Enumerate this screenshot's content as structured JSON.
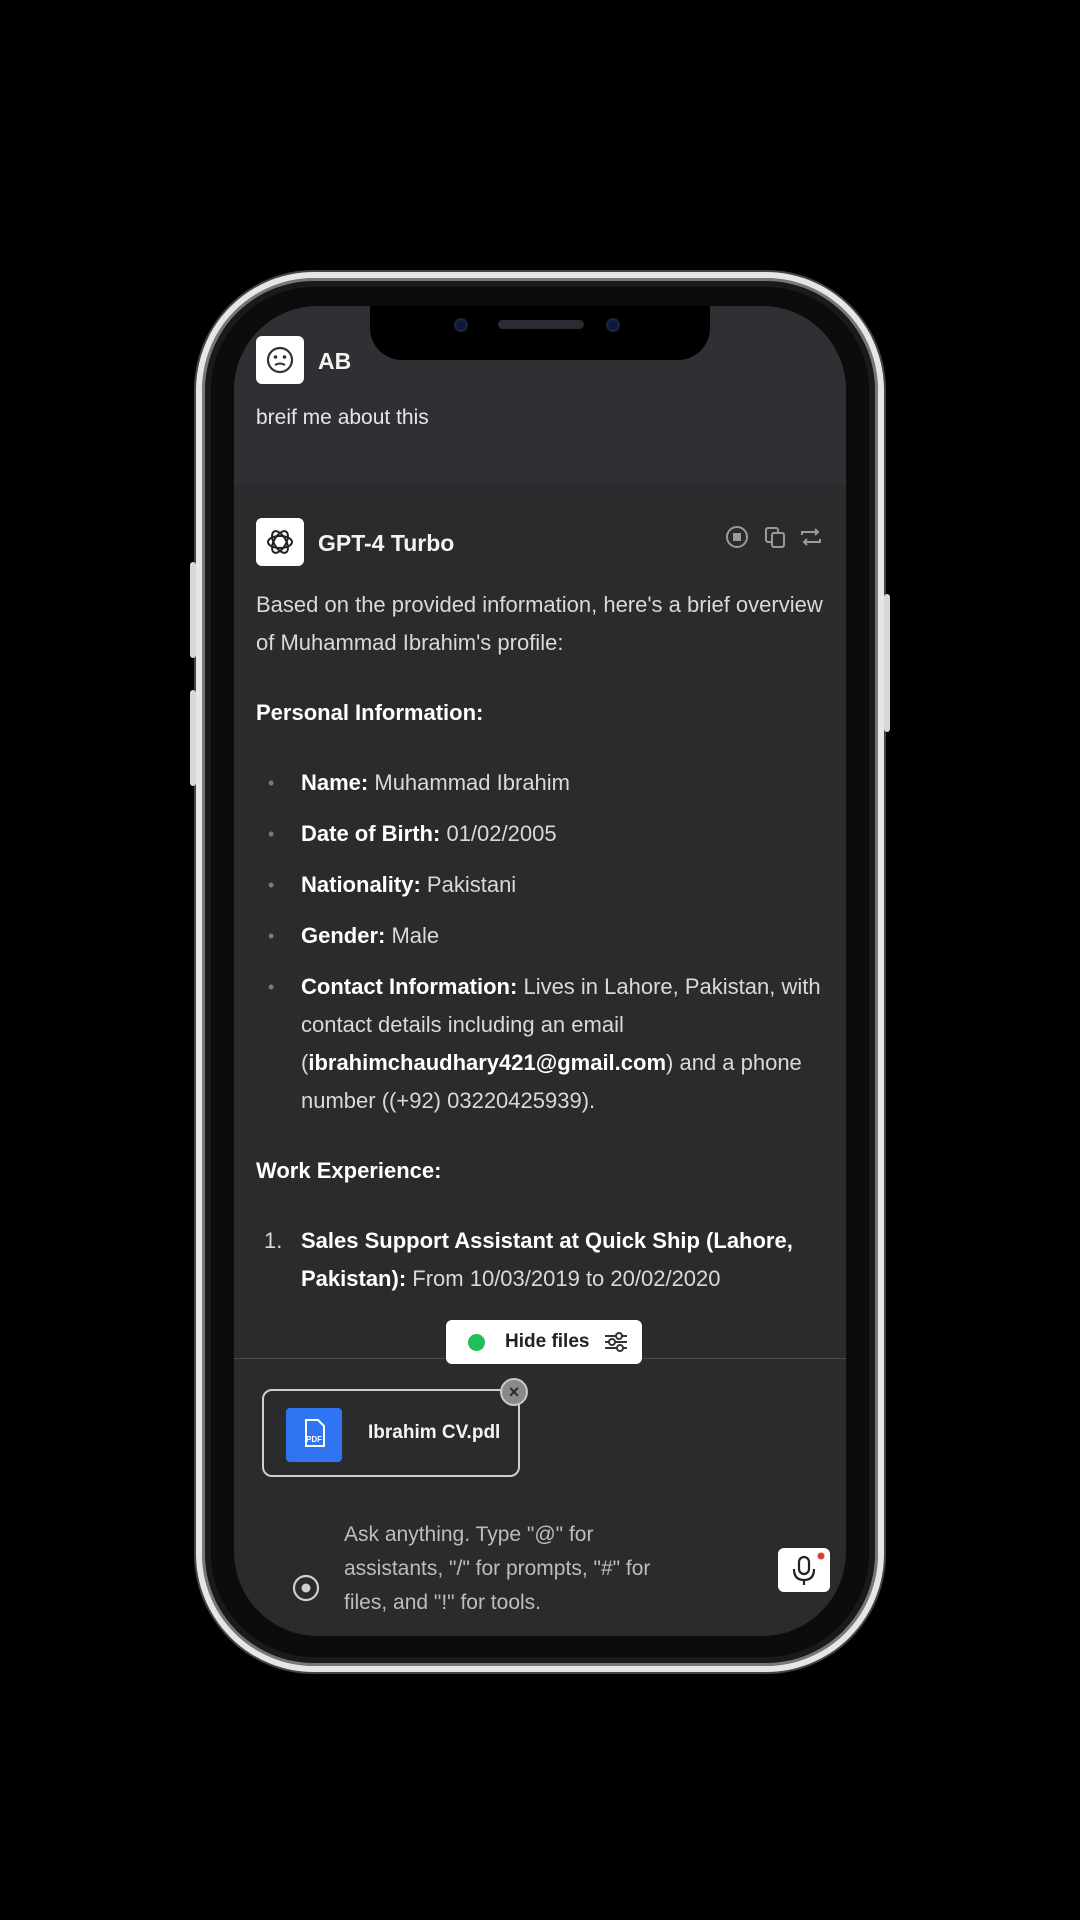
{
  "user": {
    "avatar_initials": "AB",
    "message": "breif me about this"
  },
  "assistant": {
    "model_name": "GPT-4 Turbo",
    "intro": "Based on the provided information, here's a brief overview of Muhammad Ibrahim's profile:",
    "section_personal": "Personal Information:",
    "personal_items": [
      {
        "label": "Name:",
        "value": "Muhammad Ibrahim"
      },
      {
        "label": "Date of Birth:",
        "value": "01/02/2005"
      },
      {
        "label": "Nationality:",
        "value": "Pakistani"
      },
      {
        "label": "Gender:",
        "value": "Male"
      }
    ],
    "contact_label": "Contact Information:",
    "contact_text_1": "Lives in Lahore, Pakistan, with contact details including an email (",
    "contact_email": "ibrahimchaudhary421@gmail.com",
    "contact_text_2": ") and a phone number ((+92) 03220425939).",
    "section_work": "Work Experience:",
    "work_items": [
      {
        "num": "1.",
        "title": "Sales Support Assistant at Quick Ship (Lahore, Pakistan):",
        "detail": "From 10/03/2019 to 20/02/2020"
      }
    ]
  },
  "files_toggle": {
    "label": "Hide files",
    "status_color": "#1fc05a"
  },
  "attachment": {
    "file_name": "Ibrahim CV.pdl",
    "icon": "pdf-file-icon",
    "icon_label": "PDF"
  },
  "composer": {
    "placeholder": "Ask anything. Type \"@\" for assistants, \"/\" for prompts, \"#\" for files, and \"!\" for tools."
  },
  "colors": {
    "background": "#2a2b2d",
    "accent_blue": "#2f74f0",
    "green_dot": "#1fc05a"
  }
}
